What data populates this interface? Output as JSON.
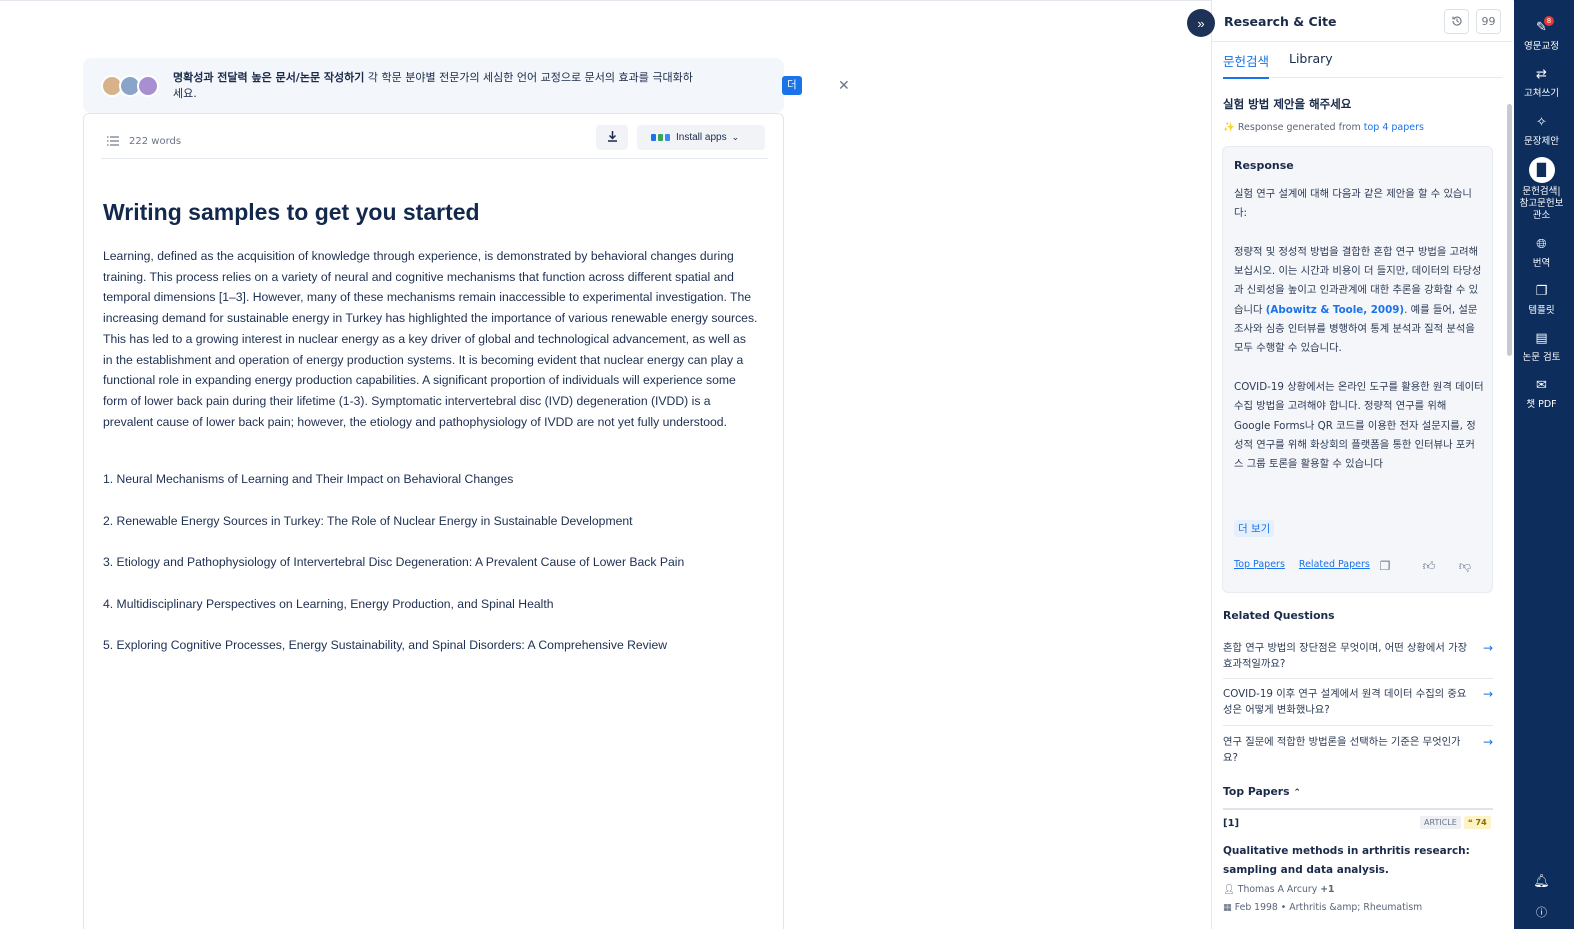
{
  "banner": {
    "bold_text": "명확성과 전달력 높은 문서/논문 작성하기",
    "text": " 각 학문 분야별 전문가의 세심한 언어 교정으로 문서의 효과를 극대화하세요.",
    "button": "더 알아보기",
    "close": "✕"
  },
  "toolbar": {
    "word_count": "222 words",
    "install_apps": "Install apps"
  },
  "document": {
    "title": "Writing samples to get you started",
    "body": "Learning, defined as the acquisition of knowledge through experience, is demonstrated by behavioral changes during training. This process relies on a variety of neural and cognitive mechanisms that function across different spatial and temporal dimensions [1–3]. However, many of these mechanisms remain inaccessible to experimental investigation. The increasing demand for sustainable energy in Turkey has highlighted the importance of various renewable energy sources. This has led to a growing interest in nuclear energy as a key driver of global and technological advancement, as well as in the establishment and operation of energy production systems. It is becoming evident that nuclear energy can play a functional role in expanding energy production capabilities. A significant proportion of individuals will experience some form of lower back pain during their lifetime (1-3). Symptomatic intervertebral disc (IVD) degeneration (IVDD) is a prevalent cause of lower back pain; however, the etiology and pathophysiology of IVDD are not yet fully understood.",
    "list": [
      "1. Neural Mechanisms of Learning and Their Impact on Behavioral Changes",
      "2. Renewable Energy Sources in Turkey: The Role of Nuclear Energy in Sustainable Development",
      "3. Etiology and Pathophysiology of Intervertebral Disc Degeneration: A Prevalent Cause of Lower Back Pain",
      "4. Multidisciplinary Perspectives on Learning, Energy Production, and Spinal Health",
      "5. Exploring Cognitive Processes, Energy Sustainability, and Spinal Disorders: A Comprehensive Review"
    ]
  },
  "panel": {
    "title": "Research & Cite",
    "quote_btn": "99",
    "tabs": [
      "문헌검색",
      "Library"
    ],
    "query": "실험 방법 제안을 해주세요",
    "gen_prefix": "Response generated from ",
    "gen_link": "top 4 papers",
    "response_label": "Response",
    "response_p1": "실험 연구 설계에 대해 다음과 같은 제안을 할 수 있습니다:",
    "response_p2a": "정량적 및 정성적 방법을 결합한 혼합 연구 방법을 고려해 보십시오. 이는 시간과 비용이 더 들지만, 데이터의 타당성과 신뢰성을 높이고 인과관계에 대한 추론을 강화할 수 있습니다 ",
    "response_cite": "(Abowitz & Toole, 2009)",
    "response_p2b": ". 예를 들어, 설문조사와 심층 인터뷰를 병행하여 통계 분석과 질적 분석을 모두 수행할 수 있습니다.",
    "response_p3": "COVID-19 상황에서는 온라인 도구를 활용한 원격 데이터 수집 방법을 고려해야 합니다. 정량적 연구를 위해 Google Forms나 QR 코드를 이용한 전자 설문지를, 정성적 연구를 위해 화상회의 플랫폼을 통한 인터뷰나 포커스 그룹 토론을 활용할 수 있습니다",
    "more": "더 보기",
    "link_top": "Top Papers",
    "link_related": "Related Papers",
    "related_title": "Related Questions",
    "related": [
      "혼합 연구 방법의 장단점은 무엇이며, 어떤 상황에서 가장 효과적일까요?",
      "COVID-19 이후 연구 설계에서 원격 데이터 수집의 중요성은 어떻게 변화했나요?",
      "연구 질문에 적합한 방법론을 선택하는 기준은 무엇인가요?"
    ],
    "top_papers_title": "Top Papers",
    "paper": {
      "num": "[1]",
      "type": "ARTICLE",
      "cites": "74",
      "title": "Qualitative methods in arthritis research: sampling and data analysis.",
      "author": "Thomas A Arcury",
      "author_more": "+1",
      "date": "Feb 1998",
      "journal": "Arthritis &amp; Rheumatism"
    }
  },
  "rail": {
    "badge": "8",
    "items": [
      "영문교정",
      "고쳐쓰기",
      "문장제안",
      "문헌검색|참고문헌보관소",
      "번역",
      "템플릿",
      "논문 검토",
      "챗 PDF"
    ]
  }
}
